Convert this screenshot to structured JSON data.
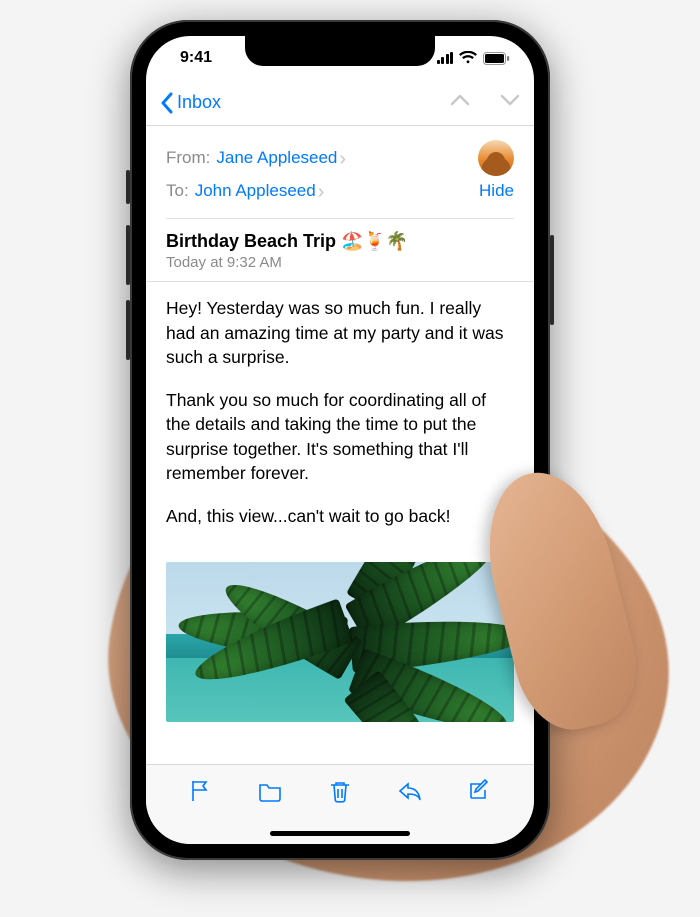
{
  "status": {
    "time": "9:41"
  },
  "nav": {
    "back_label": "Inbox"
  },
  "header": {
    "from_label": "From:",
    "from_name": "Jane Appleseed",
    "to_label": "To:",
    "to_name": "John Appleseed",
    "hide_label": "Hide"
  },
  "subject": {
    "text": "Birthday Beach Trip 🏖️🍹🌴",
    "timestamp": "Today at 9:32 AM"
  },
  "body": {
    "p1": "Hey! Yesterday was so much fun. I really had an amazing time at my party and it was such a surprise.",
    "p2": "Thank you so much for coordinating all of the details and taking the time to put the surprise together. It's something that I'll remember forever.",
    "p3": "And, this view...can't wait to go back!"
  },
  "colors": {
    "accent": "#007aff"
  }
}
